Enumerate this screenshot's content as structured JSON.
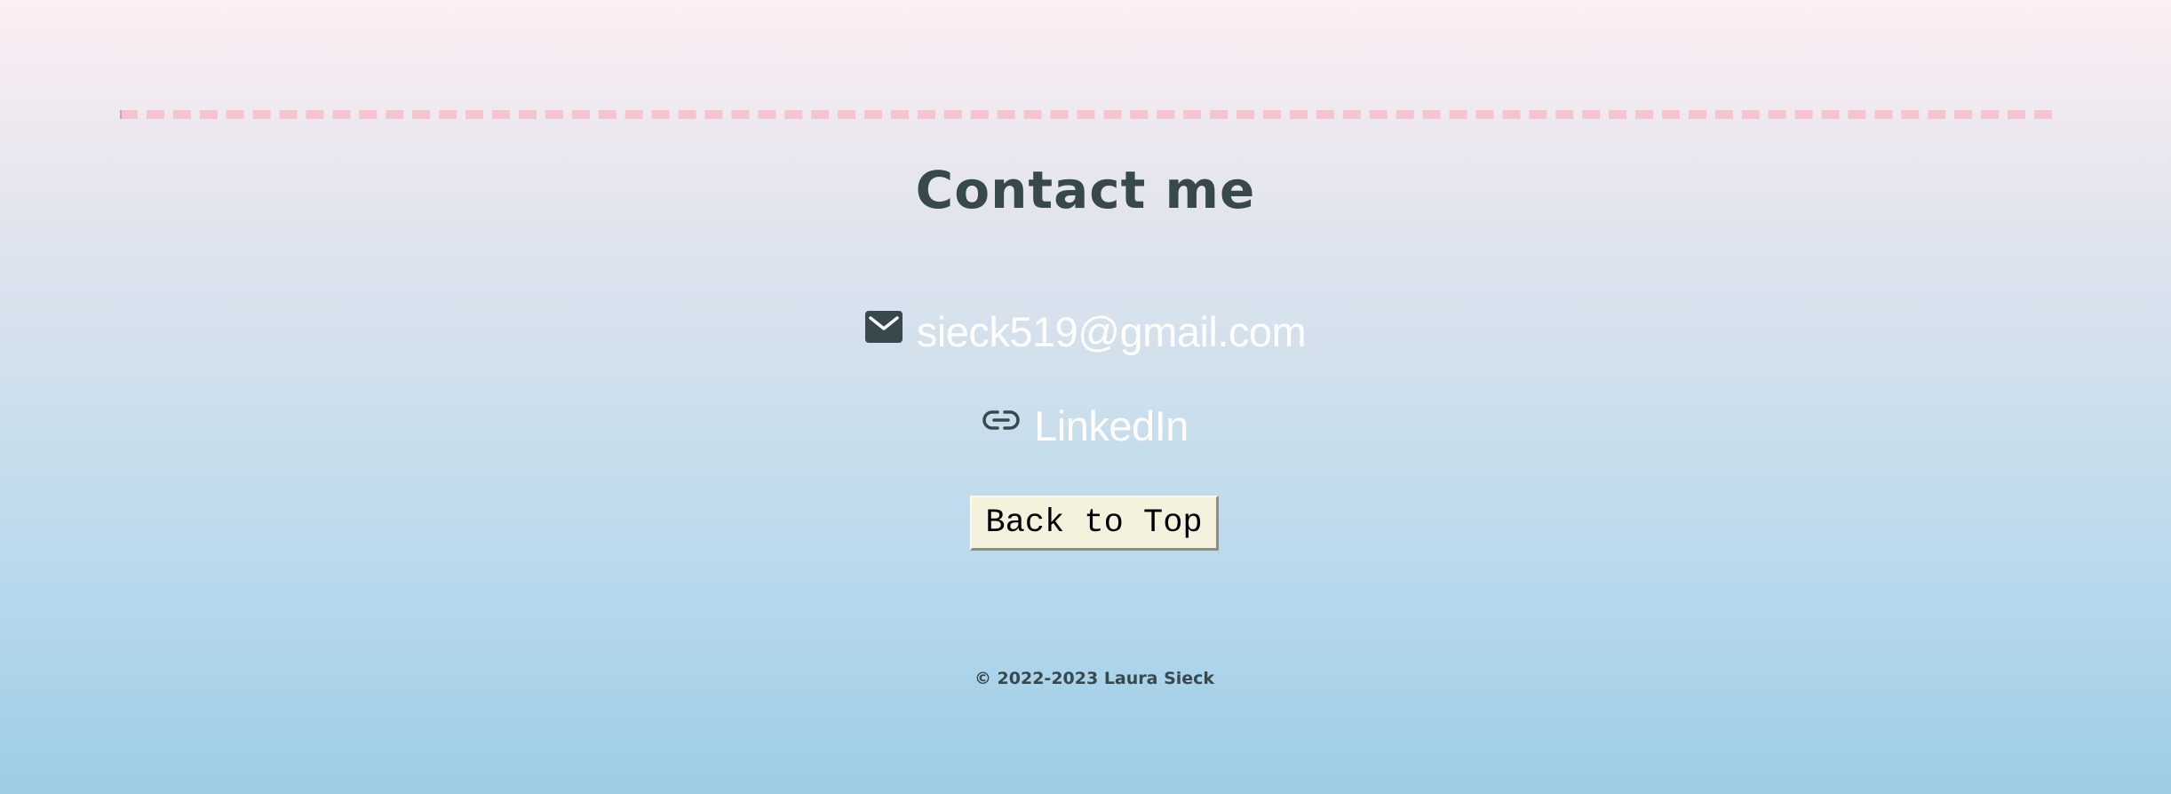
{
  "contact": {
    "heading": "Contact me",
    "email": {
      "icon": "mail-icon",
      "text": "sieck519@gmail.com"
    },
    "linkedin": {
      "icon": "link-icon",
      "text": "LinkedIn"
    },
    "back_to_top_label": "Back to Top"
  },
  "footer": {
    "copyright": "© 2022-2023 Laura Sieck"
  },
  "colors": {
    "heading": "#37494c",
    "link_text": "#ffffff",
    "divider": "#f5c4cf",
    "button_bg": "#f4f2dc",
    "background_top": "#fdeef3",
    "background_bottom": "#9ccde6"
  }
}
